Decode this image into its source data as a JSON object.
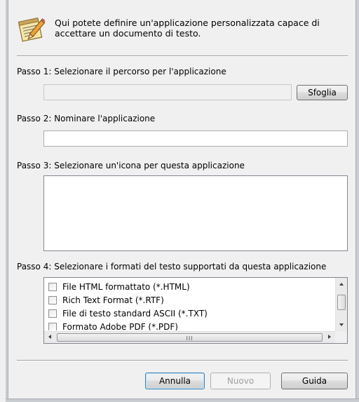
{
  "header": {
    "icon": "notepad-pencil-icon",
    "text": "Qui potete definire un'applicazione personalizzata capace di accettare un documento di testo."
  },
  "step1": {
    "label": "Passo 1: Selezionare il percorso per l'applicazione",
    "path_value": "",
    "browse_label": "Sfoglia"
  },
  "step2": {
    "label": "Passo 2: Nominare l'applicazione",
    "name_value": ""
  },
  "step3": {
    "label": "Passo 3: Selezionare un'icona per questa applicazione"
  },
  "step4": {
    "label": "Passo 4: Selezionare i formati del testo supportati da questa applicazione",
    "formats": [
      {
        "label": "File HTML formattato (*.HTML)",
        "checked": false
      },
      {
        "label": "Rich Text Format (*.RTF)",
        "checked": false
      },
      {
        "label": "File di testo standard ASCII (*.TXT)",
        "checked": false
      },
      {
        "label": "Formato Adobe PDF (*.PDF)",
        "checked": false
      }
    ],
    "scroll_grip": "III"
  },
  "buttons": {
    "cancel": "Annulla",
    "new": "Nuovo",
    "help": "Guida"
  }
}
